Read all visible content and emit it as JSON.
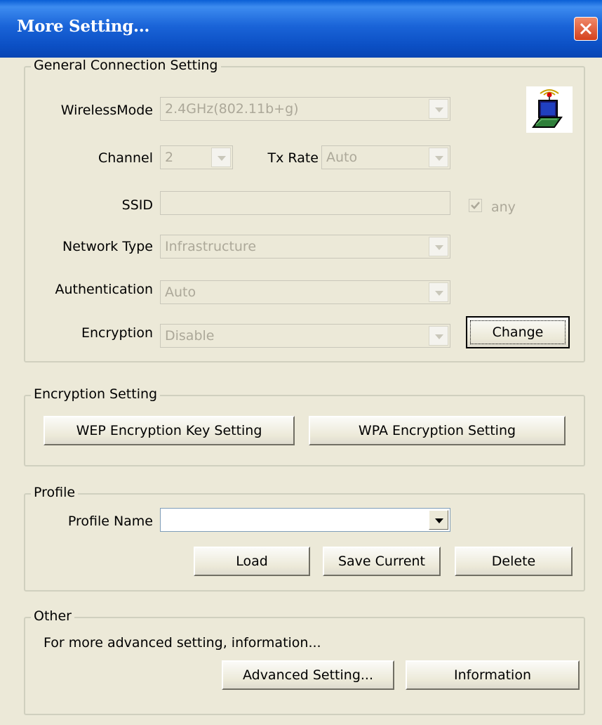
{
  "window": {
    "title": "More Setting..."
  },
  "general": {
    "title": "General Connection Setting",
    "wireless_mode": {
      "label": "WirelessMode",
      "value": "2.4GHz(802.11b+g)"
    },
    "channel": {
      "label": "Channel",
      "value": "2"
    },
    "tx_rate": {
      "label": "Tx Rate",
      "value": "Auto"
    },
    "ssid": {
      "label": "SSID",
      "value": "",
      "any_label": "any",
      "any_checked": true
    },
    "network_type": {
      "label": "Network Type",
      "value": "Infrastructure"
    },
    "authentication": {
      "label": "Authentication",
      "value": "Auto"
    },
    "encryption": {
      "label": "Encryption",
      "value": "Disable"
    },
    "change_button": "Change",
    "icon": "wireless-laptop-icon"
  },
  "encryption_setting": {
    "title": "Encryption Setting",
    "wep_button": "WEP Encryption Key Setting",
    "wpa_button": "WPA Encryption Setting"
  },
  "profile": {
    "title": "Profile",
    "name_label": "Profile Name",
    "name_value": "",
    "load_button": "Load",
    "save_button": "Save Current",
    "delete_button": "Delete"
  },
  "other": {
    "title": "Other",
    "description": "For more advanced setting, information...",
    "advanced_button": "Advanced Setting...",
    "information_button": "Information"
  },
  "colors": {
    "titlebar": "#0a4fc4",
    "face": "#ece9d8",
    "disabled_text": "#aca899",
    "close": "#d4401c"
  }
}
